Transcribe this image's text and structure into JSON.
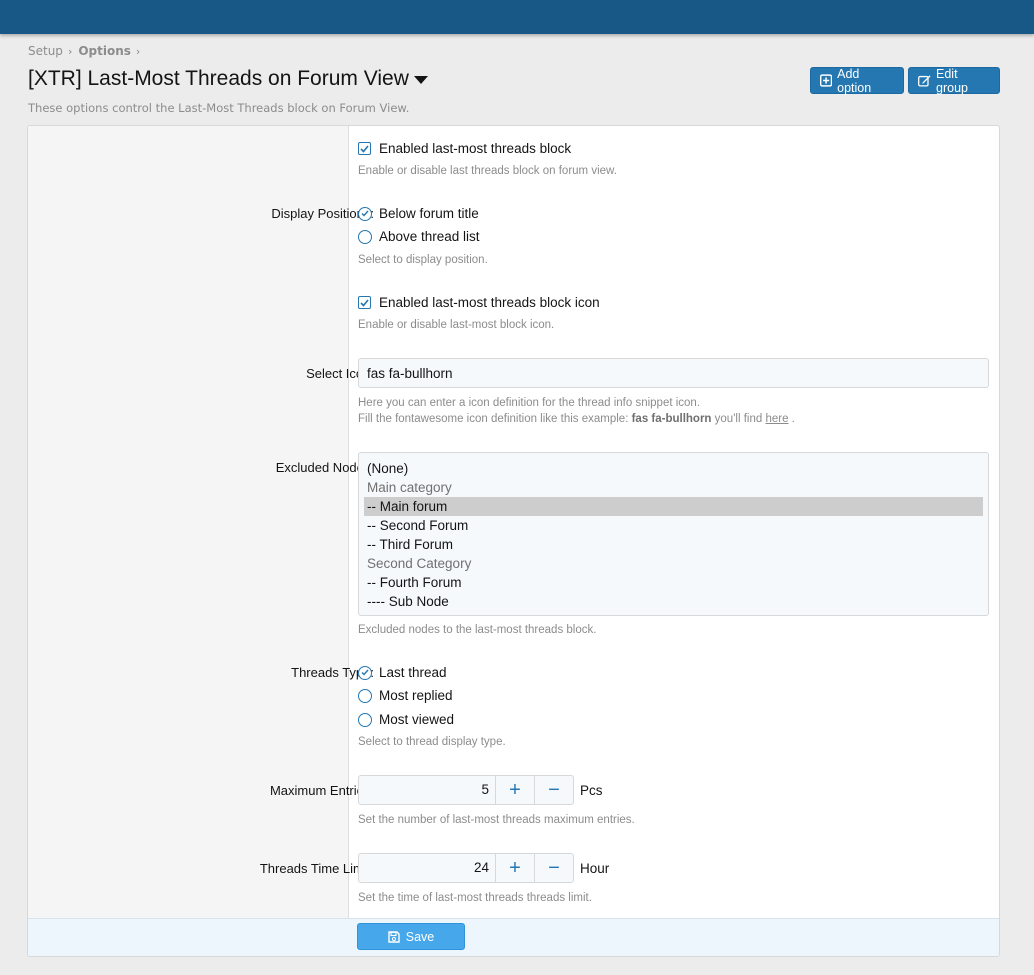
{
  "breadcrumb": {
    "items": [
      "Setup",
      "Options"
    ]
  },
  "page": {
    "title": "[XTR] Last-Most Threads on Forum View",
    "description": "These options control the Last-Most Threads block on Forum View."
  },
  "header_buttons": {
    "add_option": "Add option",
    "edit_group": "Edit group"
  },
  "options": {
    "enable_block": {
      "label": "Enabled last-most threads block",
      "checked": true,
      "hint": "Enable or disable last threads block on forum view."
    },
    "display_positions": {
      "label": "Display Positions:",
      "choices": [
        "Below forum title",
        "Above thread list"
      ],
      "selected": "Below forum title",
      "hint": "Select to display position."
    },
    "enable_icon": {
      "label": "Enabled last-most threads block icon",
      "checked": true,
      "hint": "Enable or disable last-most block icon."
    },
    "select_icon": {
      "label": "Select Icon:",
      "value": "fas fa-bullhorn",
      "hint_line1": "Here you can enter a icon definition for the thread info snippet icon.",
      "hint_line2_pre": "Fill the fontawesome icon definition like this example: ",
      "hint_line2_bold": "fas fa-bullhorn",
      "hint_line2_mid": " you'll find ",
      "hint_line2_link": "here",
      "hint_line2_post": " ."
    },
    "excluded_nodes": {
      "label": "Excluded Nodes:",
      "items": [
        "(None)",
        "Main category",
        "-- Main forum",
        "-- Second Forum",
        "-- Third Forum",
        "Second Category",
        "-- Fourth Forum",
        "---- Sub Node"
      ],
      "selected": "-- Main forum",
      "hint": "Excluded nodes to the last-most threads block."
    },
    "threads_type": {
      "label": "Threads Type:",
      "choices": [
        "Last thread",
        "Most replied",
        "Most viewed"
      ],
      "selected": "Last thread",
      "hint": "Select to thread display type."
    },
    "maximum_entries": {
      "label": "Maximum Entries:",
      "value": "5",
      "unit": "Pcs",
      "hint": "Set the number of last-most threads maximum entries."
    },
    "time_limit": {
      "label": "Threads Time Limit:",
      "value": "24",
      "unit": "Hour",
      "hint": "Set the time of last-most threads threads limit."
    }
  },
  "save_label": "Save",
  "colors": {
    "topbar": "#185886",
    "accent": "#2577b1",
    "save": "#47a7eb"
  }
}
